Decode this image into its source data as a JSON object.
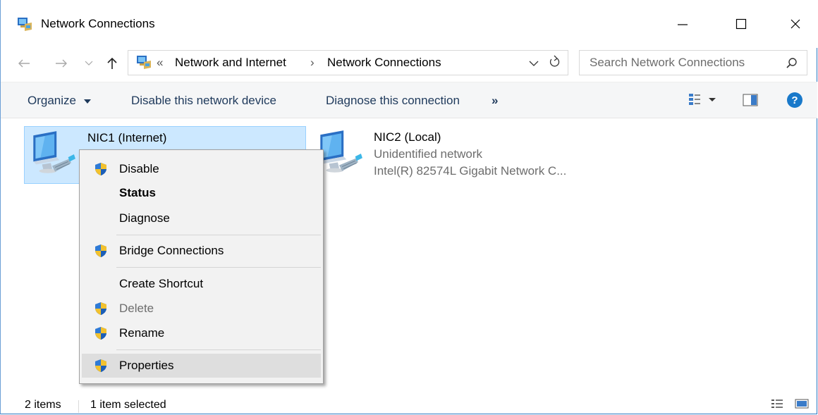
{
  "window": {
    "title": "Network Connections"
  },
  "address_bar": {
    "overflow_glyph": "«",
    "crumbs": [
      "Network and Internet",
      "Network Connections"
    ],
    "separator": "›",
    "search_placeholder": "Search Network Connections"
  },
  "command_bar": {
    "organize": "Organize",
    "disable": "Disable this network device",
    "diagnose": "Diagnose this connection",
    "more": "»"
  },
  "items": [
    {
      "name": "NIC1 (Internet)",
      "selected": true
    },
    {
      "name": "NIC2 (Local)",
      "network": "Unidentified network",
      "adapter": "Intel(R) 82574L Gigabit Network C...",
      "selected": false
    }
  ],
  "context_menu": {
    "items": [
      {
        "label": "Disable",
        "icon": "uac-shield-icon"
      },
      {
        "label": "Status",
        "bold": true
      },
      {
        "label": "Diagnose"
      },
      {
        "label": "Bridge Connections",
        "icon": "uac-shield-icon"
      },
      {
        "label": "Create Shortcut"
      },
      {
        "label": "Delete",
        "icon": "uac-shield-icon",
        "disabled": true
      },
      {
        "label": "Rename",
        "icon": "uac-shield-icon"
      },
      {
        "label": "Properties",
        "icon": "uac-shield-icon",
        "highlighted": true
      }
    ]
  },
  "status_bar": {
    "item_count": "2 items",
    "selection": "1 item selected"
  },
  "colors": {
    "selection_bg": "#cce8ff",
    "selection_border": "#99d1ff",
    "help_icon": "#1979ca",
    "command_text": "#1e395b"
  }
}
